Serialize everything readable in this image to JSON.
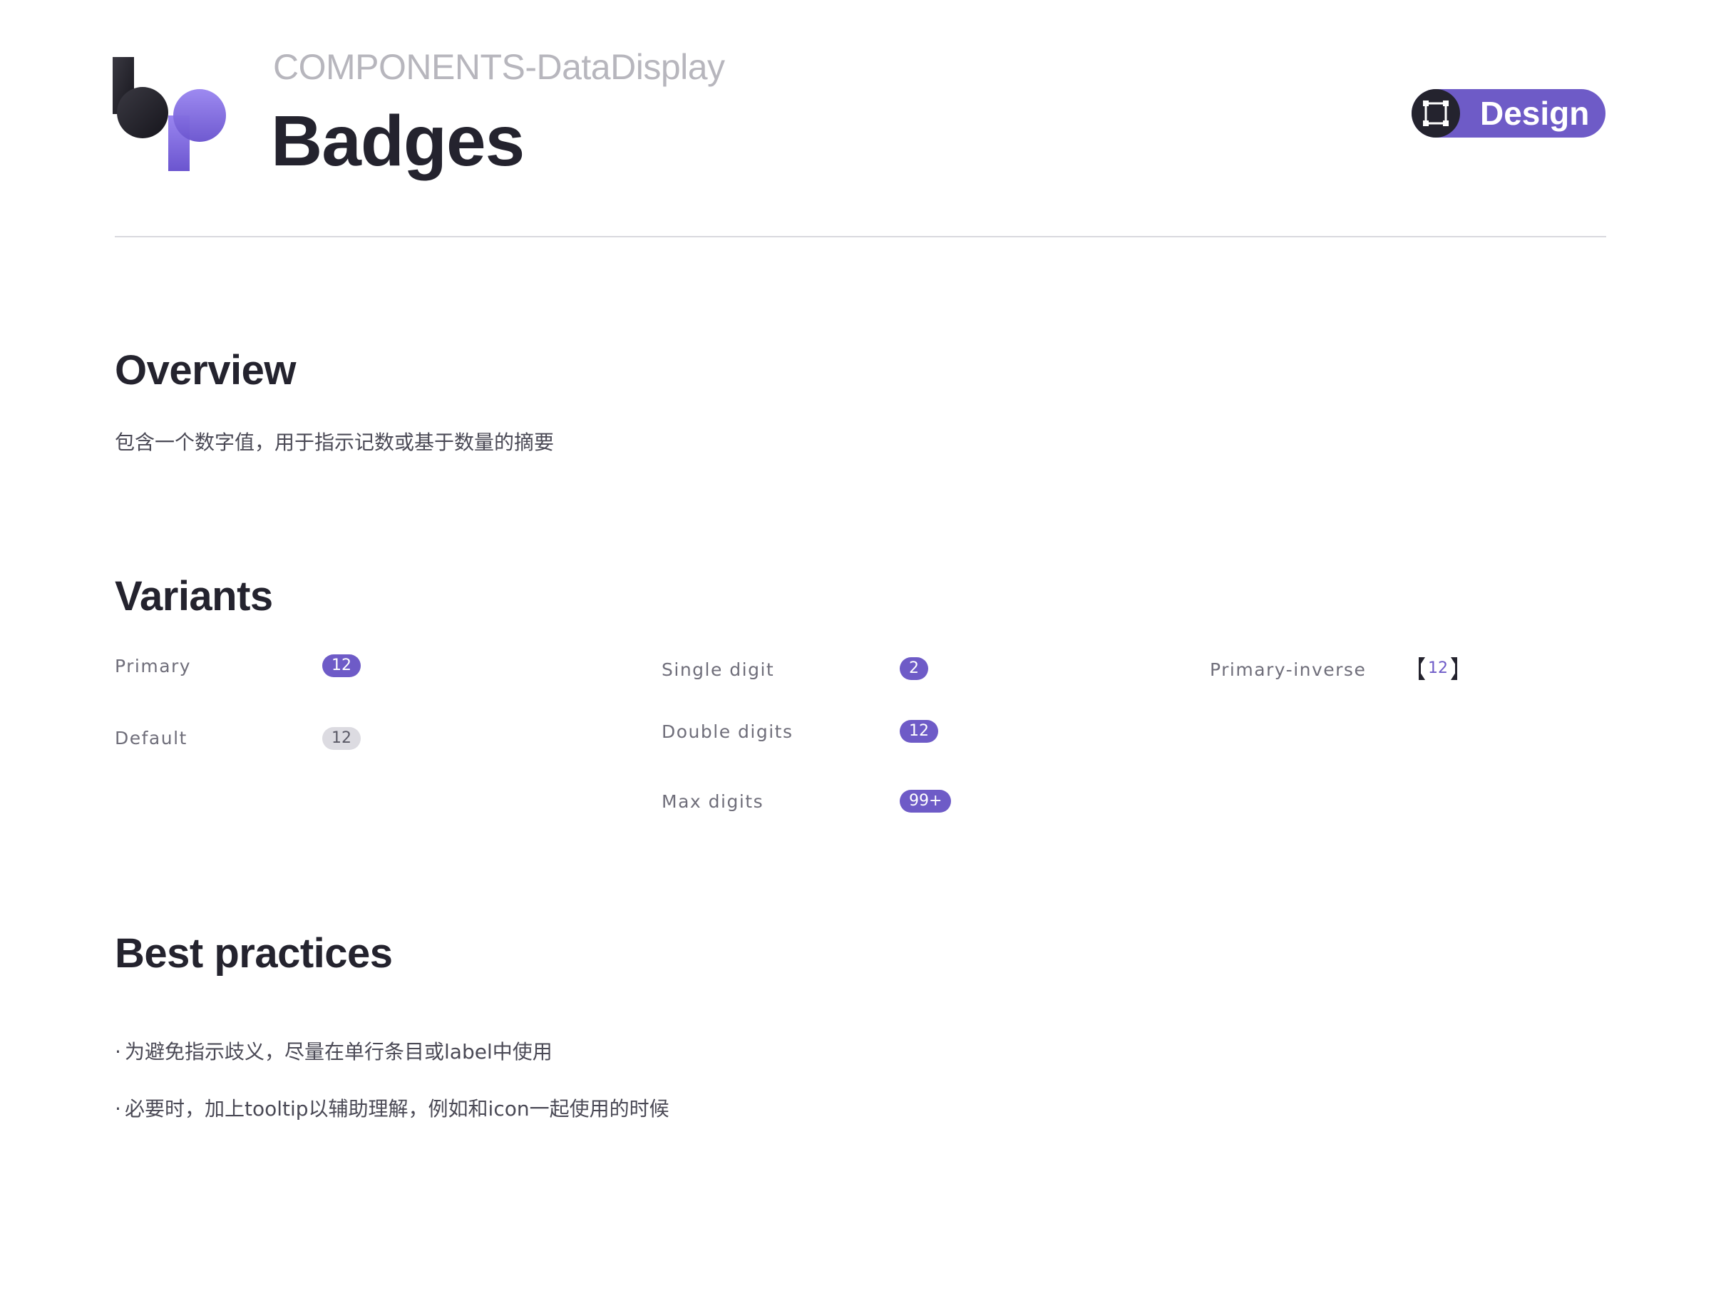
{
  "header": {
    "breadcrumb": "COMPONENTS-DataDisplay",
    "title": "Badges",
    "design_button_label": "Design"
  },
  "icons": {
    "logo": "bp-logo",
    "design": "frame-icon"
  },
  "colors": {
    "accent": "#6e5bc7",
    "text_primary": "#24232e",
    "text_muted": "#b7b6bd",
    "badge_default_bg": "#dcdbe1",
    "divider": "#d9d9de"
  },
  "overview": {
    "heading": "Overview",
    "description": "包含一个数字值，用于指示记数或基于数量的摘要"
  },
  "variants": {
    "heading": "Variants",
    "styles": [
      {
        "label": "Primary",
        "badge": "12",
        "kind": "primary"
      },
      {
        "label": "Default",
        "badge": "12",
        "kind": "default"
      }
    ],
    "sizes": [
      {
        "label": "Single digit",
        "badge": "2"
      },
      {
        "label": "Double digits",
        "badge": "12"
      },
      {
        "label": "Max digits",
        "badge": "99+"
      }
    ],
    "inverse": [
      {
        "label": "Primary-inverse",
        "badge": "12"
      }
    ]
  },
  "best_practices": {
    "heading": "Best practices",
    "items": [
      "为避免指示歧义，尽量在单行条目或label中使用",
      "必要时，加上tooltip以辅助理解，例如和icon一起使用的时候"
    ]
  }
}
